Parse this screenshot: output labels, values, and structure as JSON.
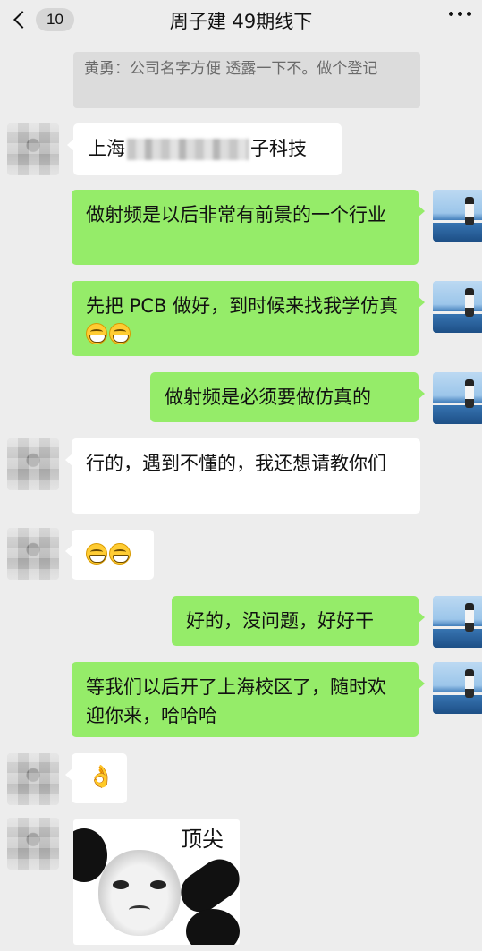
{
  "header": {
    "unread_count": "10",
    "title": "周子建  49期线下"
  },
  "system_message": "黄勇：公司名字方便 透露一下不。做个登记",
  "messages": [
    {
      "from": "other",
      "text_before": "上海",
      "text_after": "子科技"
    },
    {
      "from": "self",
      "text": "做射频是以后非常有前景的一个行业"
    },
    {
      "from": "self",
      "text": "先把 PCB 做好，到时候来找我学仿真",
      "emoji": [
        "grinning-face",
        "grinning-face"
      ]
    },
    {
      "from": "self",
      "text": "做射频是必须要做仿真的"
    },
    {
      "from": "other",
      "text": "行的，遇到不懂的，我还想请教你们"
    },
    {
      "from": "other",
      "emoji": [
        "grinning-face",
        "grinning-face"
      ]
    },
    {
      "from": "self",
      "text": "好的，没问题，好好干"
    },
    {
      "from": "self",
      "text": "等我们以后开了上海校区了，随时欢迎你来，哈哈哈"
    },
    {
      "from": "other",
      "emoji": [
        "ok-hand"
      ],
      "emoji_char": "👌"
    },
    {
      "from": "other",
      "sticker_text": "顶尖"
    }
  ],
  "colors": {
    "background": "#ededed",
    "self_bubble": "#95ec69",
    "other_bubble": "#ffffff",
    "system_bubble": "#dcdcdc"
  }
}
